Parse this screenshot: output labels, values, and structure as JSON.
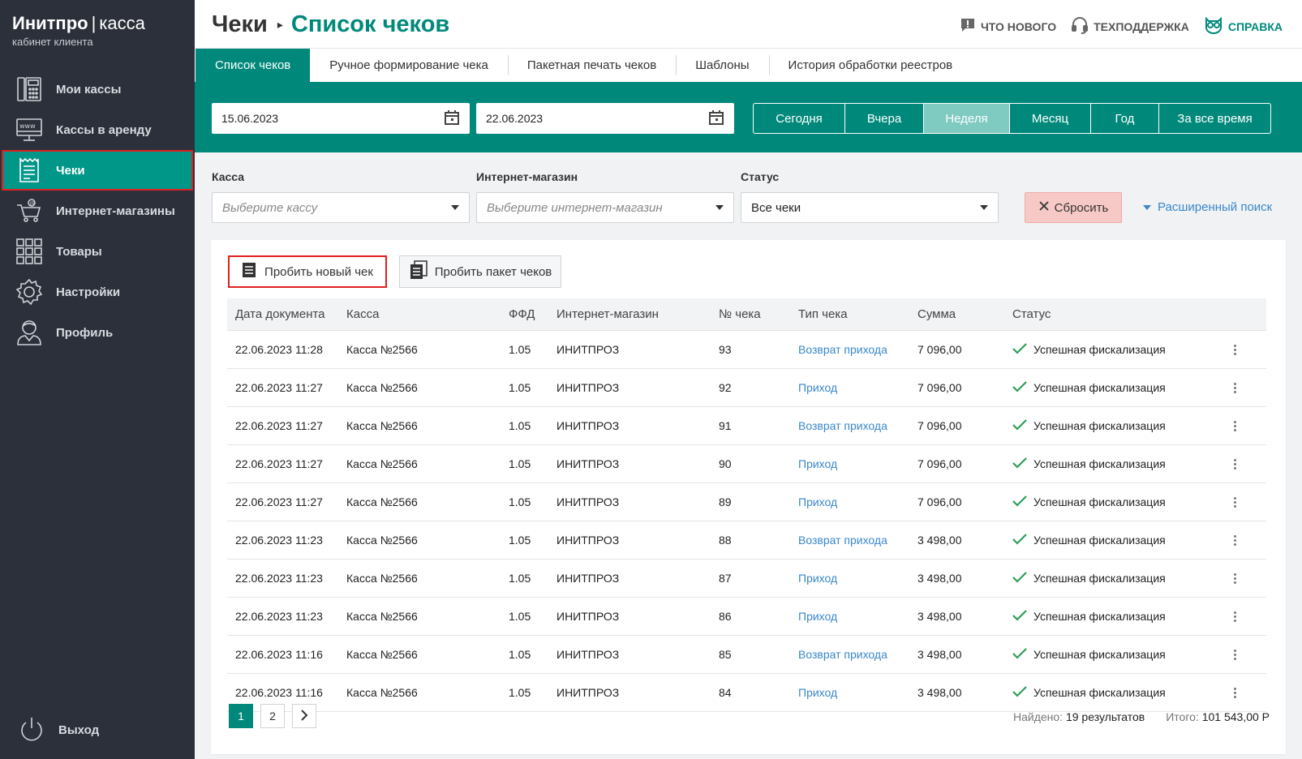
{
  "brand": {
    "name_bold": "Инитпро",
    "separator": "|",
    "name_light": "касса",
    "subtitle": "кабинет клиента"
  },
  "sidebar": {
    "items": [
      {
        "label": "Мои кассы",
        "icon": "register-icon"
      },
      {
        "label": "Кассы в аренду",
        "icon": "www-monitor-icon"
      },
      {
        "label": "Чеки",
        "icon": "receipt-icon"
      },
      {
        "label": "Интернет-магазины",
        "icon": "cart-icon"
      },
      {
        "label": "Товары",
        "icon": "grid-icon"
      },
      {
        "label": "Настройки",
        "icon": "gear-icon"
      },
      {
        "label": "Профиль",
        "icon": "user-icon"
      }
    ],
    "logout": "Выход"
  },
  "header": {
    "crumb_parent": "Чеки",
    "crumb_sep": "▸",
    "crumb_current": "Список чеков",
    "links": {
      "news": "ЧТО НОВОГО",
      "support": "ТЕХПОДДЕРЖКА",
      "help": "СПРАВКА"
    }
  },
  "tabs": [
    "Список чеков",
    "Ручное формирование чека",
    "Пакетная печать чеков",
    "Шаблоны",
    "История обработки реестров"
  ],
  "dates": {
    "from": "15.06.2023",
    "to": "22.06.2023"
  },
  "periods": [
    "Сегодня",
    "Вчера",
    "Неделя",
    "Месяц",
    "Год",
    "За все время"
  ],
  "filters": {
    "kassa_label": "Касса",
    "kassa_placeholder": "Выберите кассу",
    "shop_label": "Интернет-магазин",
    "shop_placeholder": "Выберите интернет-магазин",
    "status_label": "Статус",
    "status_value": "Все чеки",
    "reset": "Сбросить",
    "advanced": "Расширенный поиск"
  },
  "actions": {
    "new_check": "Пробить новый чек",
    "batch": "Пробить пакет чеков"
  },
  "table": {
    "headers": [
      "Дата документа",
      "Касса",
      "ФФД",
      "Интернет-магазин",
      "№ чека",
      "Тип чека",
      "Сумма",
      "Статус"
    ],
    "rows": [
      [
        "22.06.2023 11:28",
        "Касса №2566",
        "1.05",
        "ИНИТПРОЗ",
        "93",
        "Возврат прихода",
        "7 096,00",
        "Успешная фискализация"
      ],
      [
        "22.06.2023 11:27",
        "Касса №2566",
        "1.05",
        "ИНИТПРОЗ",
        "92",
        "Приход",
        "7 096,00",
        "Успешная фискализация"
      ],
      [
        "22.06.2023 11:27",
        "Касса №2566",
        "1.05",
        "ИНИТПРОЗ",
        "91",
        "Возврат прихода",
        "7 096,00",
        "Успешная фискализация"
      ],
      [
        "22.06.2023 11:27",
        "Касса №2566",
        "1.05",
        "ИНИТПРОЗ",
        "90",
        "Приход",
        "7 096,00",
        "Успешная фискализация"
      ],
      [
        "22.06.2023 11:27",
        "Касса №2566",
        "1.05",
        "ИНИТПРОЗ",
        "89",
        "Приход",
        "7 096,00",
        "Успешная фискализация"
      ],
      [
        "22.06.2023 11:23",
        "Касса №2566",
        "1.05",
        "ИНИТПРОЗ",
        "88",
        "Возврат прихода",
        "3 498,00",
        "Успешная фискализация"
      ],
      [
        "22.06.2023 11:23",
        "Касса №2566",
        "1.05",
        "ИНИТПРОЗ",
        "87",
        "Приход",
        "3 498,00",
        "Успешная фискализация"
      ],
      [
        "22.06.2023 11:23",
        "Касса №2566",
        "1.05",
        "ИНИТПРОЗ",
        "86",
        "Приход",
        "3 498,00",
        "Успешная фискализация"
      ],
      [
        "22.06.2023 11:16",
        "Касса №2566",
        "1.05",
        "ИНИТПРОЗ",
        "85",
        "Возврат прихода",
        "3 498,00",
        "Успешная фискализация"
      ],
      [
        "22.06.2023 11:16",
        "Касса №2566",
        "1.05",
        "ИНИТПРОЗ",
        "84",
        "Приход",
        "3 498,00",
        "Успешная фискализация"
      ]
    ]
  },
  "pagination": {
    "pages": [
      "1",
      "2"
    ],
    "next": "›"
  },
  "summary": {
    "found_label": "Найдено:",
    "found_value": "19 результатов",
    "total_label": "Итого:",
    "total_value": "101 543,00 Р"
  },
  "colors": {
    "accent": "#00897b",
    "sidebar": "#2b303a",
    "highlight": "#e02020",
    "link": "#3a87c9",
    "success": "#2e9d5a"
  }
}
